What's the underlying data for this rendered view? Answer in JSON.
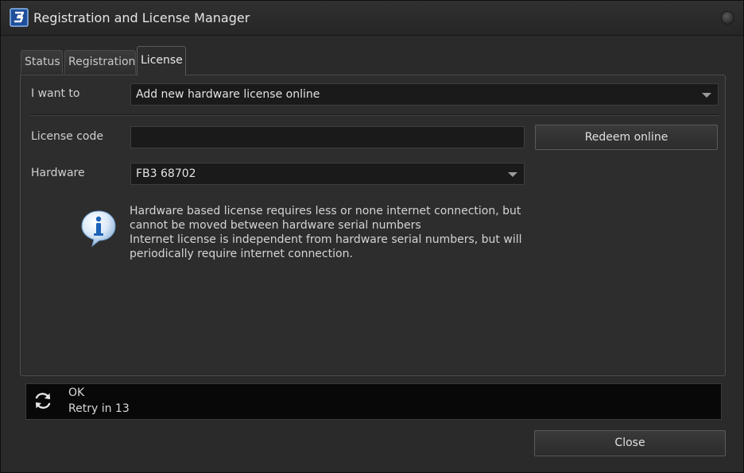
{
  "window": {
    "title": "Registration and License Manager"
  },
  "tabs": [
    {
      "label": "Status",
      "active": false
    },
    {
      "label": "Registration",
      "active": false
    },
    {
      "label": "License",
      "active": true
    }
  ],
  "license": {
    "action_label": "I want to",
    "action_value": "Add new hardware license online",
    "code_label": "License code",
    "code_value": "",
    "redeem_label": "Redeem online",
    "hardware_label": "Hardware",
    "hardware_value": "FB3 68702",
    "info_lines": [
      "Hardware based license requires less or none internet connection, but",
      "cannot be moved between hardware serial numbers",
      "Internet license is independent from hardware serial numbers, but will",
      "periodically require internet connection."
    ]
  },
  "status": {
    "line1": "OK",
    "line2": "Retry in 13",
    "icon": "refresh-icon"
  },
  "footer": {
    "close_label": "Close"
  },
  "colors": {
    "background": "#2a2a2a",
    "panel": "#2d2d2d",
    "field": "#1a1a1a",
    "status_bg": "#080808",
    "accent_blue": "#3a7fd0"
  }
}
